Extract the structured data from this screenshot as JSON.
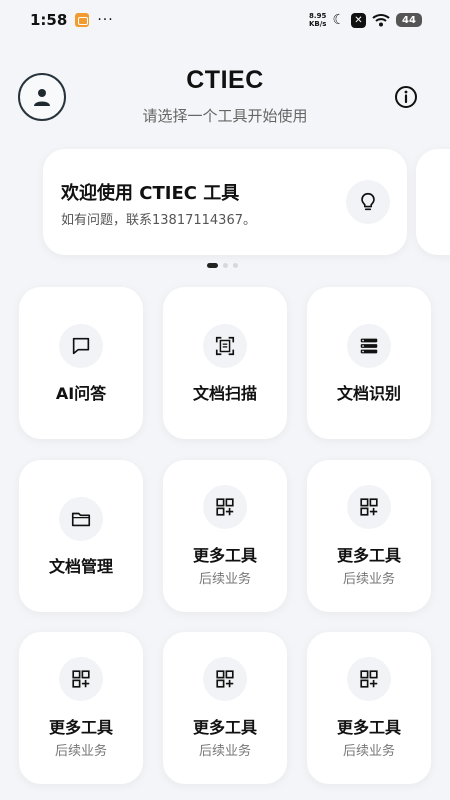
{
  "status": {
    "time": "1:58",
    "more": "···",
    "net_speed_value": "8.95",
    "net_speed_unit": "KB/s",
    "battery": "44"
  },
  "header": {
    "title": "CTIEC",
    "subtitle": "请选择一个工具开始使用"
  },
  "banner": {
    "title": "欢迎使用 CTIEC 工具",
    "text": "如有问题，联系13817114367。"
  },
  "tools": [
    {
      "label": "AI问答",
      "icon": "chat-icon"
    },
    {
      "label": "文档扫描",
      "icon": "scan-icon"
    },
    {
      "label": "文档识别",
      "icon": "list-icon"
    },
    {
      "label": "文档管理",
      "icon": "folder-icon"
    },
    {
      "label": "更多工具",
      "sub": "后续业务",
      "icon": "grid-add-icon"
    },
    {
      "label": "更多工具",
      "sub": "后续业务",
      "icon": "grid-add-icon"
    },
    {
      "label": "更多工具",
      "sub": "后续业务",
      "icon": "grid-add-icon"
    },
    {
      "label": "更多工具",
      "sub": "后续业务",
      "icon": "grid-add-icon"
    },
    {
      "label": "更多工具",
      "sub": "后续业务",
      "icon": "grid-add-icon"
    }
  ],
  "colors": {
    "background": "#f4f5f8",
    "card": "#ffffff",
    "icon_circle": "#f1f3f6",
    "text_primary": "#111111",
    "text_secondary": "#666666"
  }
}
